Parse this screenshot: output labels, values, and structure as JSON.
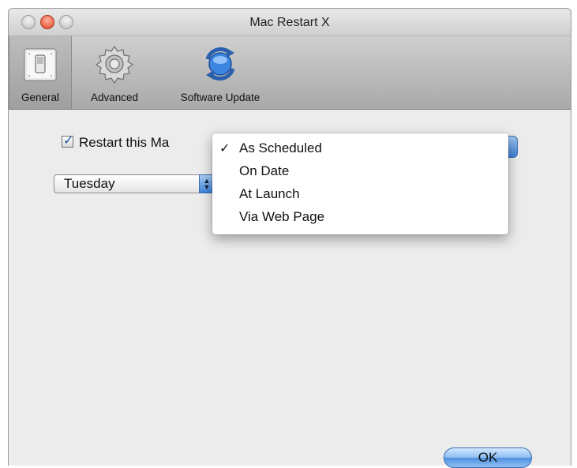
{
  "window": {
    "title": "Mac Restart X"
  },
  "toolbar": {
    "items": [
      {
        "label": "General",
        "icon": "light-switch-icon",
        "selected": true
      },
      {
        "label": "Advanced",
        "icon": "gear-icon",
        "selected": false
      },
      {
        "label": "Software Update",
        "icon": "sync-arrows-icon",
        "selected": false
      }
    ]
  },
  "general": {
    "restart_checkbox_label": "Restart this Ma",
    "restart_checked": true,
    "day_select_value": "Tuesday"
  },
  "schedule_menu": {
    "items": [
      {
        "label": "As Scheduled",
        "checked": true,
        "check_glyph": "✓"
      },
      {
        "label": "On Date",
        "checked": false,
        "check_glyph": ""
      },
      {
        "label": "At Launch",
        "checked": false,
        "check_glyph": ""
      },
      {
        "label": "Via Web Page",
        "checked": false,
        "check_glyph": ""
      }
    ]
  },
  "footer": {
    "ok_label": "OK"
  },
  "colors": {
    "accent": "#3e83d9",
    "close_button_red": "#e0401c"
  }
}
